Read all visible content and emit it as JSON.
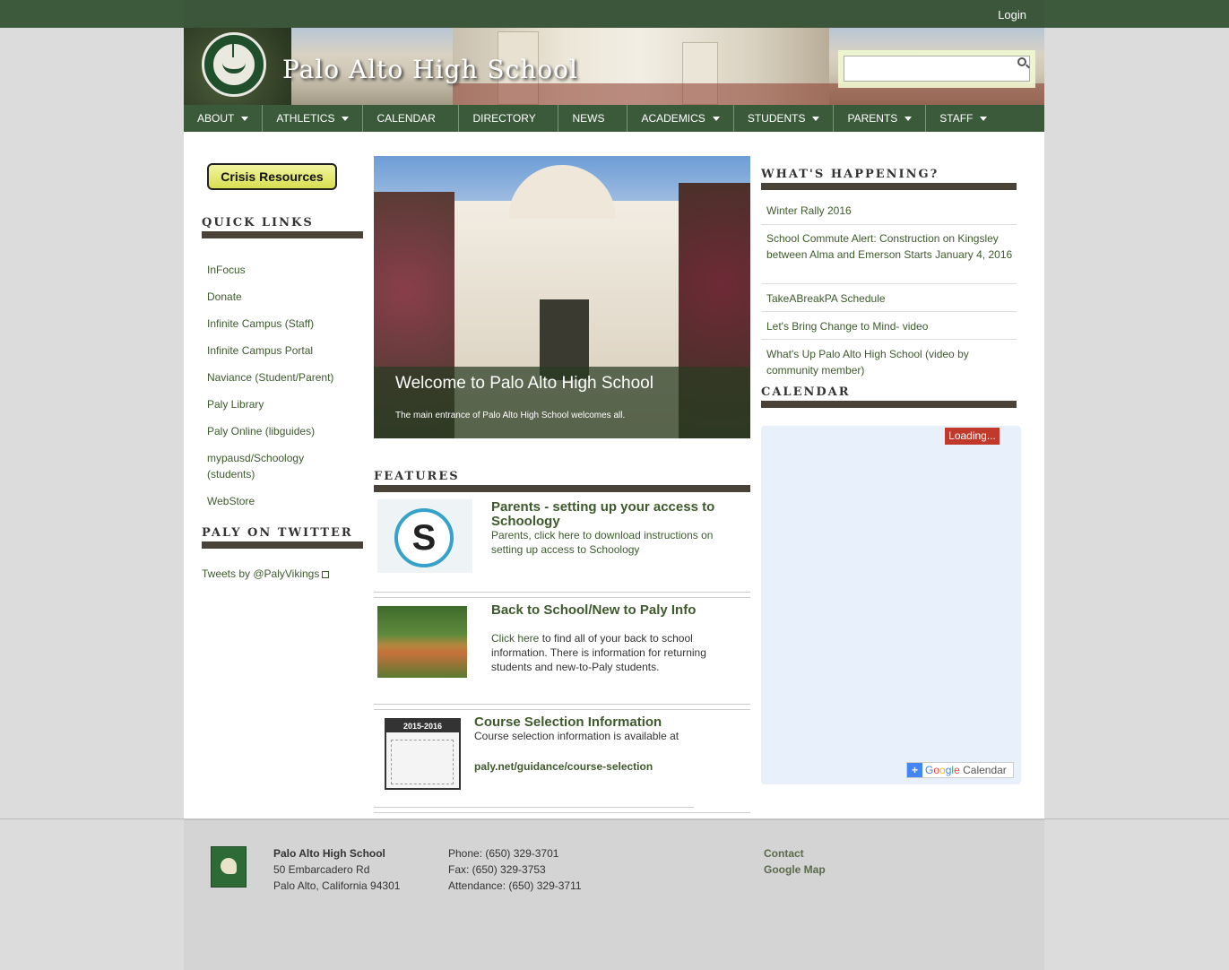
{
  "topbar": {
    "login": "Login"
  },
  "header": {
    "site_title": "Palo Alto High School",
    "search_placeholder": ""
  },
  "nav": [
    {
      "label": "ABOUT",
      "has_menu": true
    },
    {
      "label": "ATHLETICS",
      "has_menu": true
    },
    {
      "label": "CALENDAR",
      "has_menu": false
    },
    {
      "label": "DIRECTORY",
      "has_menu": false
    },
    {
      "label": "NEWS",
      "has_menu": false
    },
    {
      "label": "ACADEMICS",
      "has_menu": true
    },
    {
      "label": "STUDENTS",
      "has_menu": true
    },
    {
      "label": "PARENTS",
      "has_menu": true
    },
    {
      "label": "STAFF",
      "has_menu": true
    }
  ],
  "sidebar": {
    "crisis_label": "Crisis Resources",
    "quick_links_heading": "QUICK LINKS",
    "quick_links": [
      "InFocus",
      "Donate",
      "Infinite Campus (Staff)",
      "Infinite Campus Portal",
      "Naviance (Student/Parent)",
      "Paly Library",
      "Paly Online (libguides)",
      "mypausd/Schoology (students)",
      "WebStore"
    ],
    "twitter_heading": "PALY ON TWITTER",
    "twitter_link": "Tweets by @PalyVikings"
  },
  "slideshow": {
    "title": "Welcome to Palo Alto High School",
    "caption": "The main entrance of Palo Alto High School welcomes all."
  },
  "features": {
    "heading": "FEATURES",
    "items": [
      {
        "title": "Parents - setting up your access to Schoology",
        "text": "Parents, click here to download instructions on setting up access to Schoology"
      },
      {
        "title": "Back to School/New to Paly Info",
        "link": "Click here",
        "text": " to find all of your back to school information. There is information for returning students and new-to-Paly students."
      },
      {
        "title": "Course Selection Information",
        "text": "Course selection information is available at",
        "link": "paly.net/guidance/course-selection",
        "thumb_label": "2015-2016"
      }
    ]
  },
  "whats_happening": {
    "heading": "WHAT'S HAPPENING?",
    "items": [
      "Winter Rally 2016",
      "School Commute Alert: Construction on Kingsley between Alma and Emerson Starts January 4, 2016",
      "TakeABreakPA Schedule",
      "Let's Bring Change to Mind- video",
      "What's Up Palo Alto High School (video by community member)"
    ]
  },
  "calendar": {
    "heading": "CALENDAR",
    "loading": "Loading...",
    "gcal_google": [
      "G",
      "o",
      "o",
      "g",
      "l",
      "e"
    ],
    "gcal_calendar": " Calendar"
  },
  "footer": {
    "school_name": "Palo Alto High School",
    "address1": "50 Embarcadero Rd",
    "address2": "Palo Alto, California 94301",
    "phone": "Phone: (650) 329-3701",
    "fax": "Fax: (650) 329-3753",
    "attendance": "Attendance: (650) 329-3711",
    "contact": "Contact",
    "map": "Google Map"
  }
}
